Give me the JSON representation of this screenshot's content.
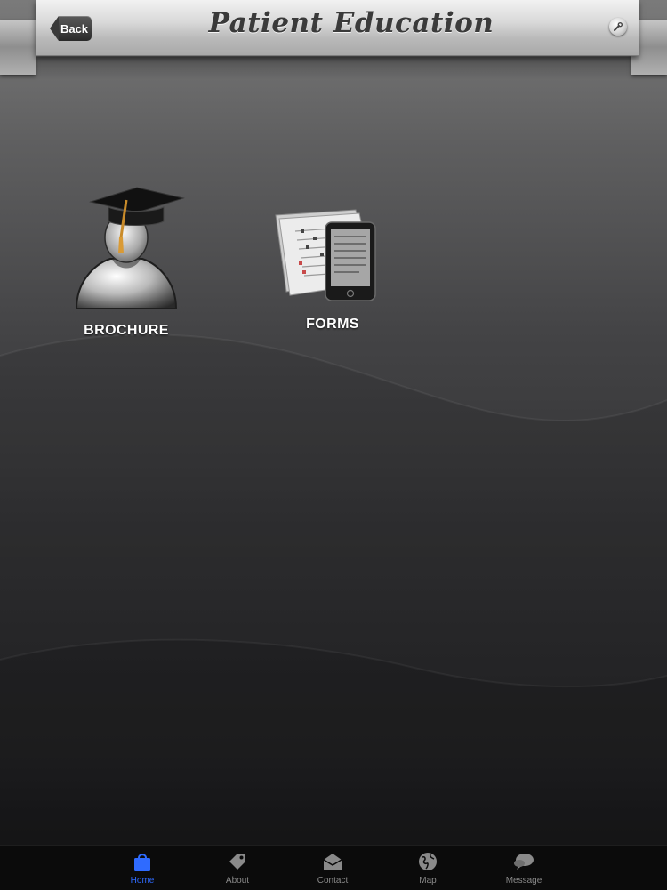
{
  "header": {
    "title": "Patient Education",
    "back_label": "Back",
    "settings_icon": "wrench-icon"
  },
  "grid": {
    "items": [
      {
        "label": "BROCHURE",
        "icon": "graduate-icon"
      },
      {
        "label": "FORMS",
        "icon": "forms-tablet-icon"
      }
    ]
  },
  "tabs": [
    {
      "label": "Home",
      "icon": "bag-icon",
      "active": true
    },
    {
      "label": "About",
      "icon": "tag-icon",
      "active": false
    },
    {
      "label": "Contact",
      "icon": "envelope-icon",
      "active": false
    },
    {
      "label": "Map",
      "icon": "globe-icon",
      "active": false
    },
    {
      "label": "Message",
      "icon": "chat-bubble-icon",
      "active": false
    }
  ],
  "colors": {
    "active_tab": "#2f6bff",
    "inactive_tab": "#8a8a8a",
    "tab_bar": "#0b0b0b"
  }
}
